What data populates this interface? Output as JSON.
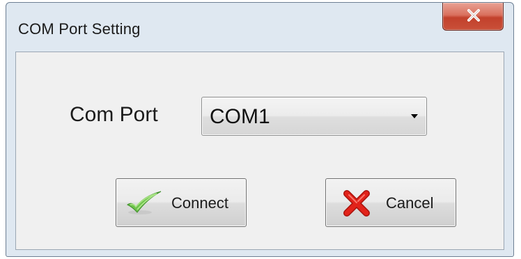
{
  "window": {
    "title": "COM Port Setting"
  },
  "form": {
    "com_port_label": "Com Port",
    "com_port_selected": "COM1"
  },
  "buttons": {
    "connect_label": "Connect",
    "cancel_label": "Cancel"
  },
  "icons": {
    "close": "close-icon",
    "connect": "checkmark-icon",
    "cancel": "red-x-icon",
    "dropdown": "dropdown-arrow-icon"
  },
  "colors": {
    "close_button": "#c94f38",
    "checkmark": "#6cc24a",
    "cancel_x": "#e2231a",
    "dialog_frame": "#dfe8f1",
    "client_area": "#f0f0f0"
  }
}
